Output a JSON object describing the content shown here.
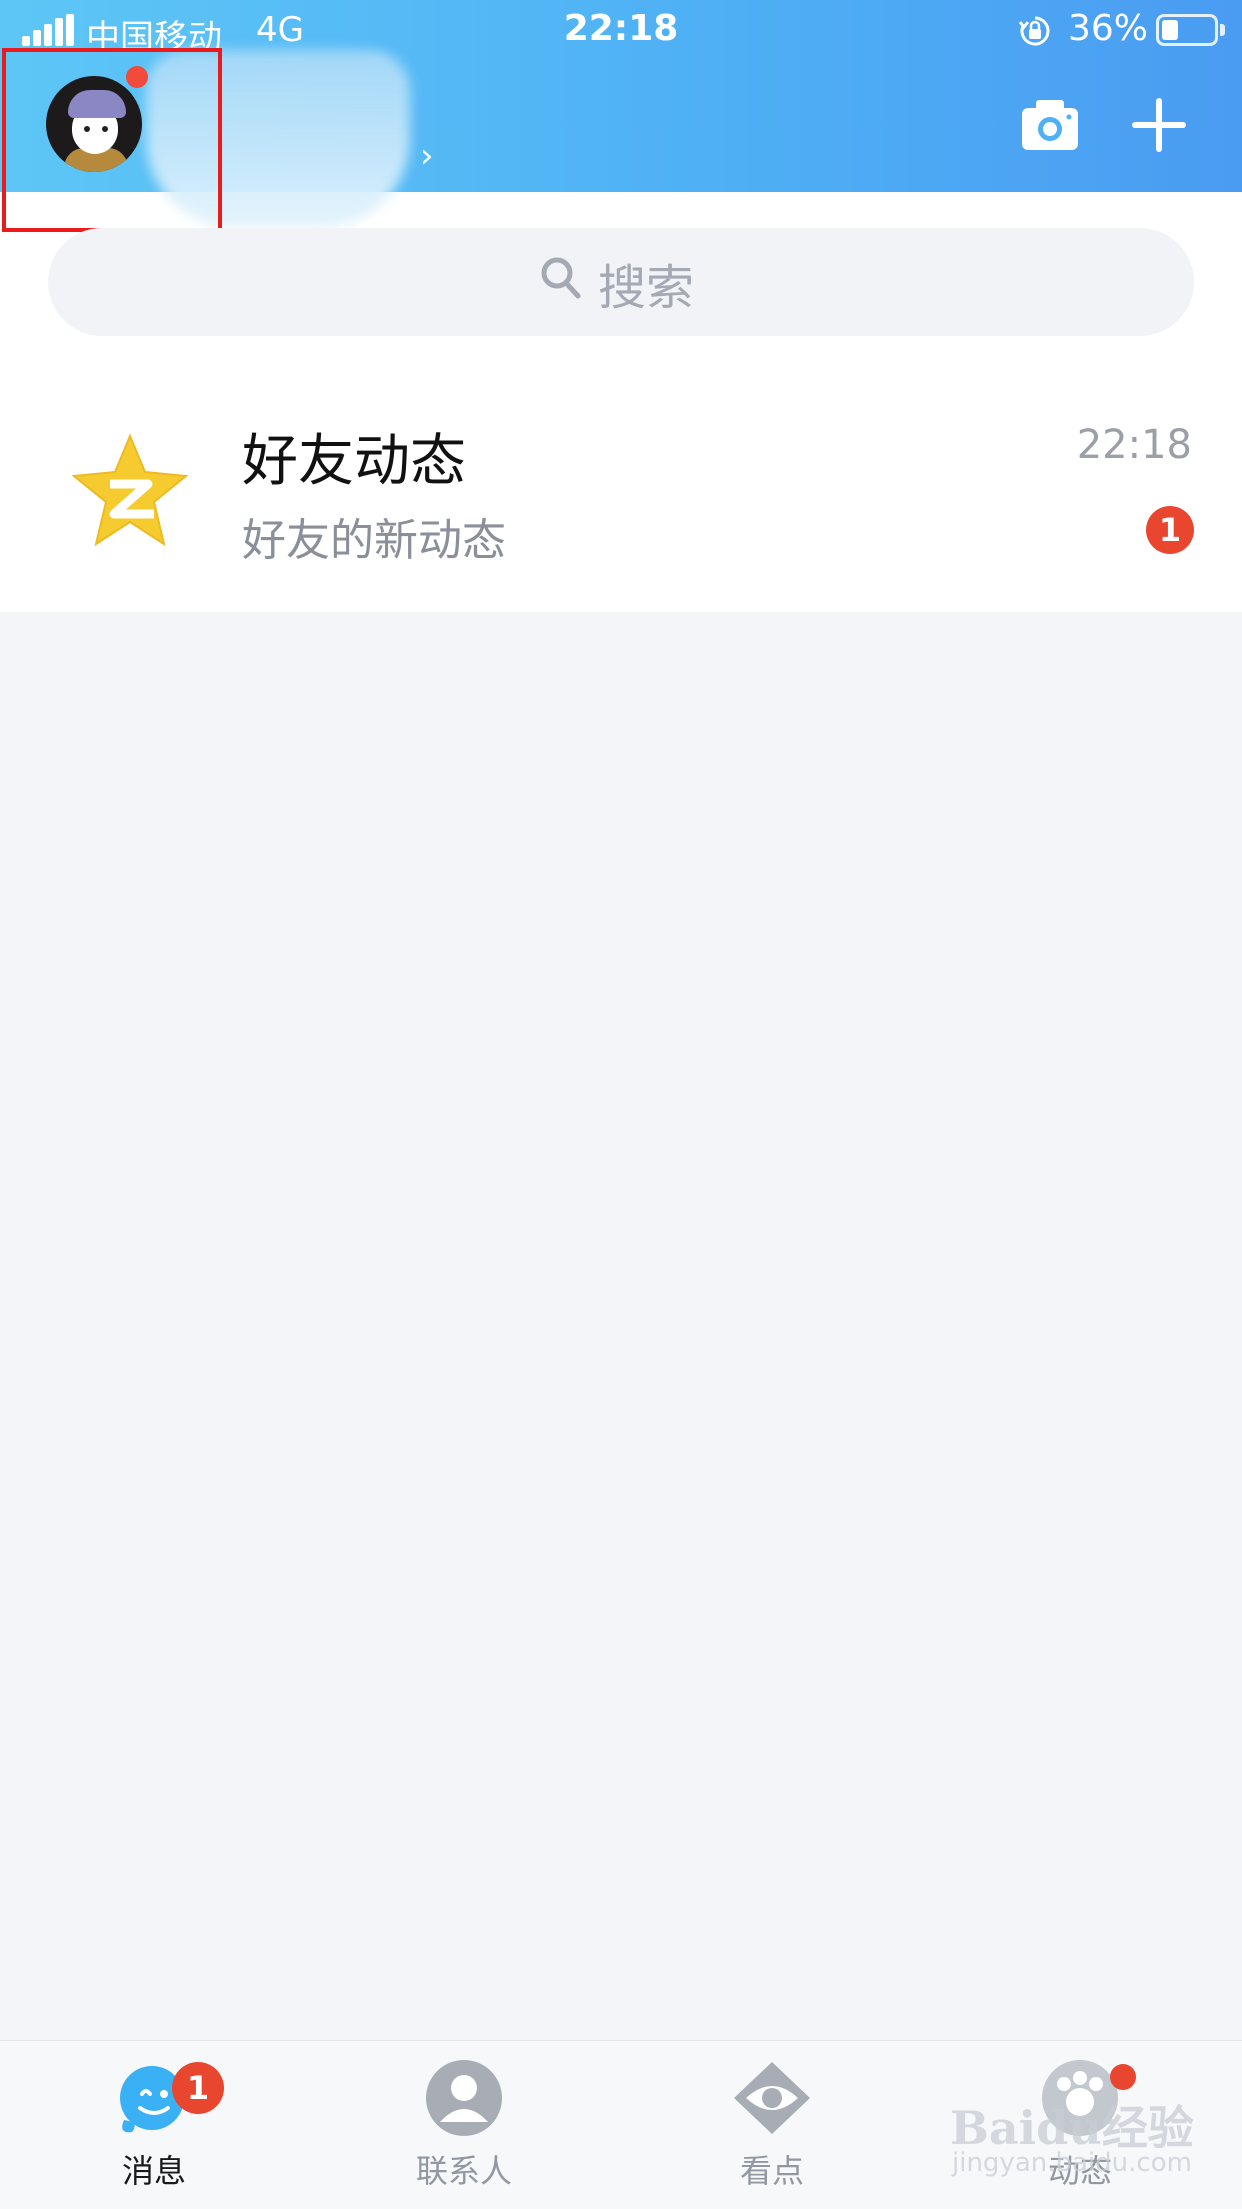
{
  "status_bar": {
    "carrier": "中国移动",
    "network": "4G",
    "time": "22:18",
    "battery": "36%"
  },
  "header": {
    "name_chevron": "›",
    "actions": [
      "camera-icon",
      "plus-icon"
    ]
  },
  "search": {
    "placeholder": "搜索"
  },
  "conversations": [
    {
      "title": "好友动态",
      "subtitle": "好友的新动态",
      "time": "22:18",
      "unread": "1",
      "icon": "qzone-star-icon"
    }
  ],
  "tabs": [
    {
      "label": "消息",
      "badge": "1",
      "active": true
    },
    {
      "label": "联系人"
    },
    {
      "label": "看点"
    },
    {
      "label": "动态",
      "dot": true
    }
  ],
  "watermark": {
    "brand": "Baidu经验",
    "url": "jingyan.baidu.com"
  },
  "colors": {
    "header_start": "#5ec6f6",
    "header_end": "#4a9cf2",
    "badge_red": "#e8462f",
    "highlight_red": "#e81c1c"
  }
}
